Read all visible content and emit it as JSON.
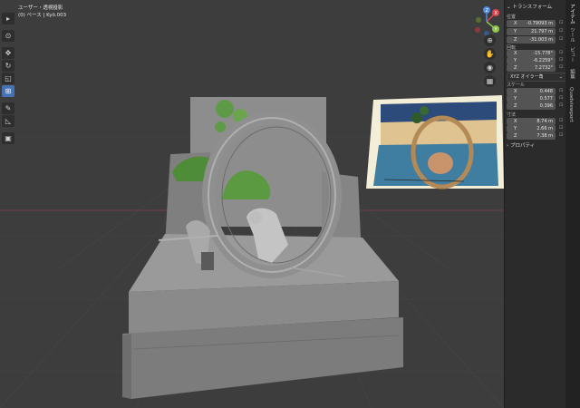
{
  "viewport": {
    "mode_label": "ユーザー・透視投影",
    "object_label": "(0) ベース | Kyô.003"
  },
  "toolbar": {
    "icons": [
      "select-tool-icon",
      "cursor-tool-icon",
      "move-tool-icon",
      "rotate-tool-icon",
      "scale-tool-icon",
      "transform-tool-icon",
      "annotate-tool-icon",
      "measure-tool-icon",
      "add-cube-tool-icon"
    ],
    "active": "transform-tool-icon"
  },
  "gizmo": {
    "axes": [
      "X",
      "Y",
      "Z"
    ]
  },
  "panel": {
    "title": "トランスフォーム",
    "location_label": "位置",
    "location": [
      {
        "axis": "X",
        "value": "-0.79093 m"
      },
      {
        "axis": "Y",
        "value": "21.797 m"
      },
      {
        "axis": "Z",
        "value": "-31.003 m"
      }
    ],
    "rotation_label": "回転",
    "rotation": [
      {
        "axis": "X",
        "value": "-15.778°"
      },
      {
        "axis": "Y",
        "value": "-6.2259°"
      },
      {
        "axis": "Z",
        "value": "7.2732°"
      }
    ],
    "rotation_mode": "XYZ オイラー角",
    "scale_label": "スケール",
    "scale": [
      {
        "axis": "X",
        "value": "0.448"
      },
      {
        "axis": "Y",
        "value": "0.577"
      },
      {
        "axis": "Z",
        "value": "0.396"
      }
    ],
    "dimensions_label": "寸法",
    "dimensions": [
      {
        "axis": "X",
        "value": "8.74 m"
      },
      {
        "axis": "Y",
        "value": "2.66 m"
      },
      {
        "axis": "Z",
        "value": "7.38 m"
      }
    ],
    "properties_label": "プロパティ"
  },
  "tabs": [
    "アイテム",
    "ツール",
    "ビュー",
    "編集",
    "Quadviewport"
  ],
  "colors": {
    "accent": "#4772b3",
    "x_axis": "#e0454f",
    "y_axis": "#8bc34a",
    "z_axis": "#4f8be0"
  }
}
